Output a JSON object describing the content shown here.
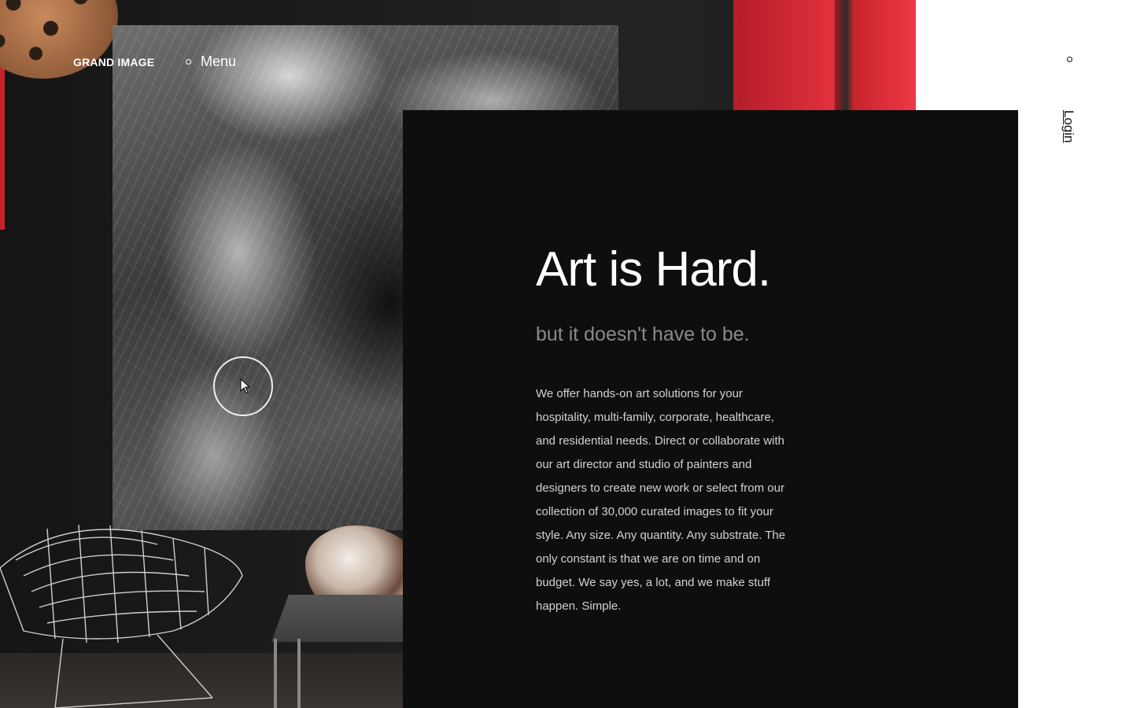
{
  "header": {
    "logo": "GRAND IMAGE",
    "menu_label": "Menu"
  },
  "hero": {
    "headline": "Art is Hard.",
    "subheadline": "but it doesn't have to be.",
    "body": "We offer hands-on art solutions for your hospitality, multi-family, corporate, healthcare, and residential needs. Direct or collaborate with our art director and studio of painters and designers to create new work or select from our collection of 30,000 curated images to fit your style. Any size. Any quantity. Any substrate. The only constant is that we are on time and on budget. We say yes, a lot, and we make stuff happen. Simple."
  },
  "aside": {
    "login_label": "Login"
  },
  "colors": {
    "accent_red": "#e2313d",
    "panel_bg": "#0e0e0e",
    "page_bg": "#ffffff"
  },
  "icons": {
    "menu": "circle-dot-icon",
    "video": "play-ring-icon",
    "login": "circle-dot-icon"
  }
}
